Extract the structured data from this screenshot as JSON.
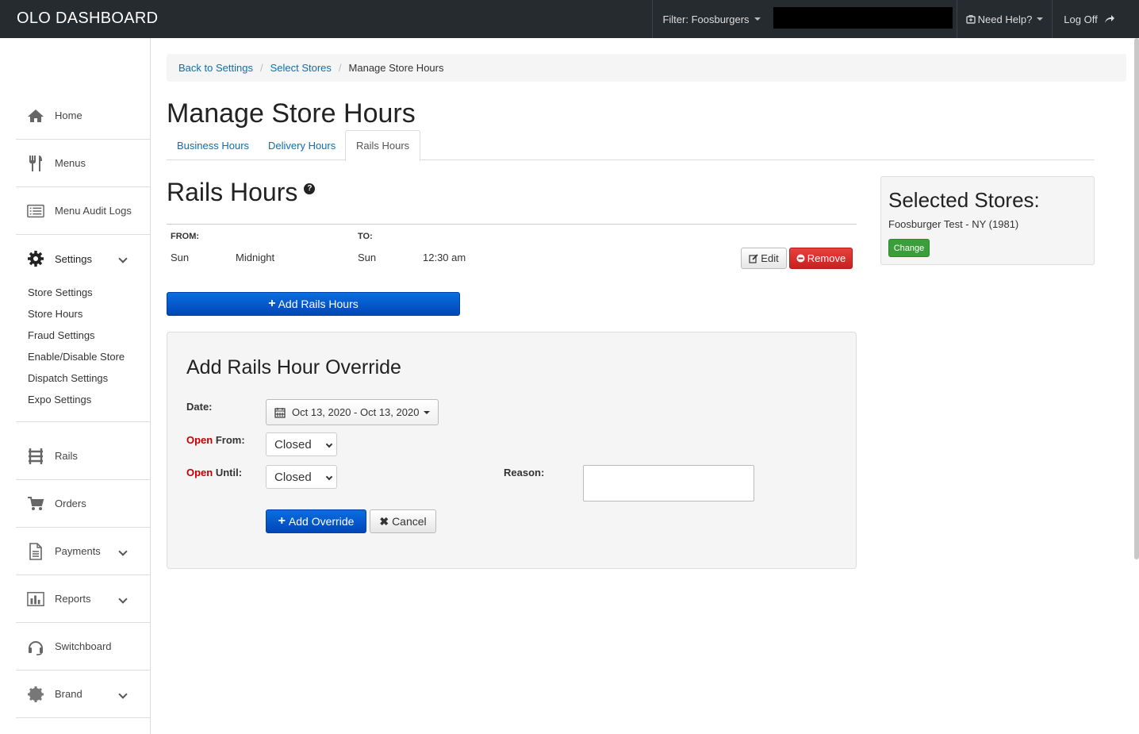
{
  "app": {
    "title": "OLO DASHBOARD"
  },
  "topbar": {
    "filter_label": "Filter: Foosburgers",
    "help_label": "Need Help?",
    "logoff_label": "Log Off"
  },
  "sidebar": {
    "items": [
      {
        "label": "Home",
        "icon": "home-icon"
      },
      {
        "label": "Menus",
        "icon": "fork-knife-icon"
      },
      {
        "label": "Menu Audit Logs",
        "icon": "list-icon"
      },
      {
        "label": "Settings",
        "icon": "gear-icon"
      },
      {
        "label": "Rails",
        "icon": "rails-icon"
      },
      {
        "label": "Orders",
        "icon": "cart-icon"
      },
      {
        "label": "Payments",
        "icon": "document-icon"
      },
      {
        "label": "Reports",
        "icon": "bar-chart-icon"
      },
      {
        "label": "Switchboard",
        "icon": "headset-icon"
      },
      {
        "label": "Brand",
        "icon": "badge-icon"
      }
    ],
    "settings_sub": [
      "Store Settings",
      "Store Hours",
      "Fraud Settings",
      "Enable/Disable Store",
      "Dispatch Settings",
      "Expo Settings"
    ]
  },
  "breadcrumb": [
    "Back to Settings",
    "Select Stores",
    "Manage Store Hours"
  ],
  "page": {
    "title": "Manage Store Hours",
    "tabs": [
      "Business Hours",
      "Delivery Hours",
      "Rails Hours"
    ],
    "active_tab": "Rails Hours",
    "section_title": "Rails Hours"
  },
  "hours_table": {
    "from_label": "FROM:",
    "to_label": "TO:",
    "rows": [
      {
        "from_day": "Sun",
        "from_time": "Midnight",
        "to_day": "Sun",
        "to_time": "12:30 am"
      }
    ],
    "edit_label": "Edit",
    "remove_label": "Remove"
  },
  "add_rails_label": "Add Rails Hours",
  "override": {
    "title": "Add Rails Hour Override",
    "date_label": "Date:",
    "date_value": "Oct 13, 2020 - Oct 13, 2020",
    "open_word": "Open",
    "from_suffix": " From:",
    "until_suffix": " Until:",
    "open_from_value": "Closed",
    "open_until_value": "Closed",
    "reason_label": "Reason:",
    "add_label": "Add Override",
    "cancel_label": "Cancel"
  },
  "selected_stores": {
    "title": "Selected Stores:",
    "store": "Foosburger Test - NY (1981)",
    "change_label": "Change"
  }
}
